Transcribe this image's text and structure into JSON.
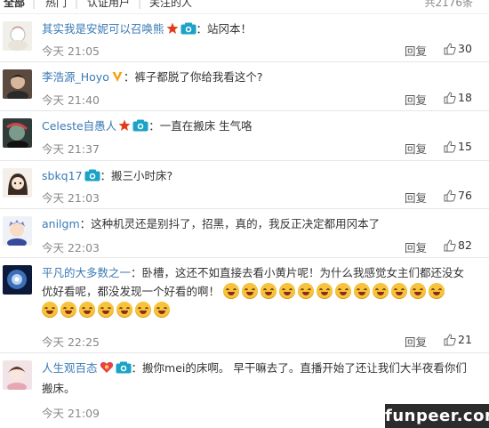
{
  "tabs": {
    "items": [
      "全部",
      "热门",
      "认证用户",
      "关注的人"
    ],
    "total": "共2176条"
  },
  "common": {
    "reply_label": "回复"
  },
  "comments": [
    {
      "user": "其实我是安妮可以召唤熊",
      "text": "：站冈本！",
      "time": "今天 21:05",
      "likes": "30"
    },
    {
      "user": "李浩源_Hoyo",
      "text": "：裤子都脱了你给我看这个?",
      "time": "今天 21:40",
      "likes": "18"
    },
    {
      "user": "Celeste自愚人",
      "text": "：一直在搬床 生气咯",
      "time": "今天 21:37",
      "likes": "15"
    },
    {
      "user": "sbkq17",
      "text": "：搬三小时床?",
      "time": "今天 21:03",
      "likes": "76"
    },
    {
      "user": "anilgm",
      "text": "：这种机灵还是别抖了，招黑，真的，我反正决定都用冈本了",
      "time": "今天 22:03",
      "likes": "82"
    },
    {
      "user": "平凡的大多数之一",
      "text": "：卧槽，这还不如直接去看小黄片呢！为什么我感觉女主们都还没女",
      "text2": "优好看呢，都没发现一个好看的啊！",
      "time": "今天 22:25",
      "likes": "21"
    },
    {
      "user": "人生观百态",
      "text": "：搬你mei的床啊。 早干嘛去了。直播开始了还让我们大半夜看你们",
      "text2": "搬床。",
      "time": "今天 21:09",
      "likes": "45"
    }
  ],
  "watermark": "funpeer.com",
  "icons": {
    "camera_badge": "camera-icon",
    "star_badge": "star-icon",
    "vip_badge": "v-badge-icon",
    "heart_badge": "heart-icon",
    "like": "thumbs-up-icon",
    "emoji": "laugh-cry-emoji"
  },
  "colors": {
    "username": "#3a7ab5",
    "camera": "#1aa3c6",
    "star": "#e43a1c",
    "vip": "#f2a30f"
  }
}
